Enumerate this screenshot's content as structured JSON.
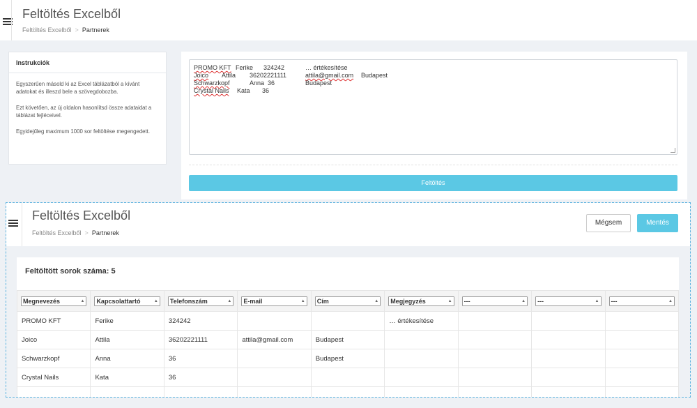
{
  "header": {
    "title": "Feltöltés Excelből",
    "breadcrumb": {
      "parent": "Feltöltés Excelből",
      "separator": ">",
      "current": "Partnerek"
    }
  },
  "instructions": {
    "heading": "Instrukciók",
    "paragraphs": [
      "Egyszerűen másold ki az Excel táblázatból a kívánt adatokat és illeszd bele a szövegdobozba.",
      "Ezt követően, az új oldalon hasonlítsd össze adataidat a táblázat fejléceivel.",
      "Egyidejűleg maximum 1000 sor feltöltése megengedett."
    ]
  },
  "paste": {
    "lines": [
      [
        "PROMO KFT",
        "Ferike",
        "324242",
        "",
        "… értékesítése"
      ],
      [
        "Joico",
        "Attila",
        "36202221111",
        "attila@gmail.com",
        "Budapest"
      ],
      [
        "Schwarzkopf",
        "Anna",
        "36",
        "",
        "Budapest"
      ],
      [
        "Crystal Nails",
        "Kata",
        "36",
        "",
        ""
      ]
    ],
    "upload_label": "Feltöltés"
  },
  "result": {
    "header_title": "Feltöltés Excelből",
    "breadcrumb": {
      "parent": "Feltöltés Excelből",
      "separator": ">",
      "current": "Partnerek"
    },
    "cancel_label": "Mégsem",
    "save_label": "Mentés",
    "count_label": "Feltöltött sorok száma: 5",
    "columns": [
      "Megnevezés",
      "Kapcsolattartó",
      "Telefonszám",
      "E-mail",
      "Cím",
      "Megjegyzés",
      "---",
      "---",
      "---"
    ],
    "rows": [
      [
        "PROMO KFT",
        "Ferike",
        "324242",
        "",
        "",
        "… értékesítése",
        "",
        "",
        ""
      ],
      [
        "Joico",
        "Attila",
        "36202221111",
        "attila@gmail.com",
        "Budapest",
        "",
        "",
        "",
        ""
      ],
      [
        "Schwarzkopf",
        "Anna",
        "36",
        "",
        "Budapest",
        "",
        "",
        "",
        ""
      ],
      [
        "Crystal Nails",
        "Kata",
        "36",
        "",
        "",
        "",
        "",
        "",
        ""
      ],
      [
        "",
        "",
        "",
        "",
        "",
        "",
        "",
        "",
        ""
      ]
    ]
  },
  "colors": {
    "accent": "#5bc8e4",
    "dashed_border": "#5bb3e0",
    "background": "#eef1f5"
  },
  "icons": {
    "menu": "hamburger-icon",
    "dropdown": "caret-updown-icon"
  }
}
